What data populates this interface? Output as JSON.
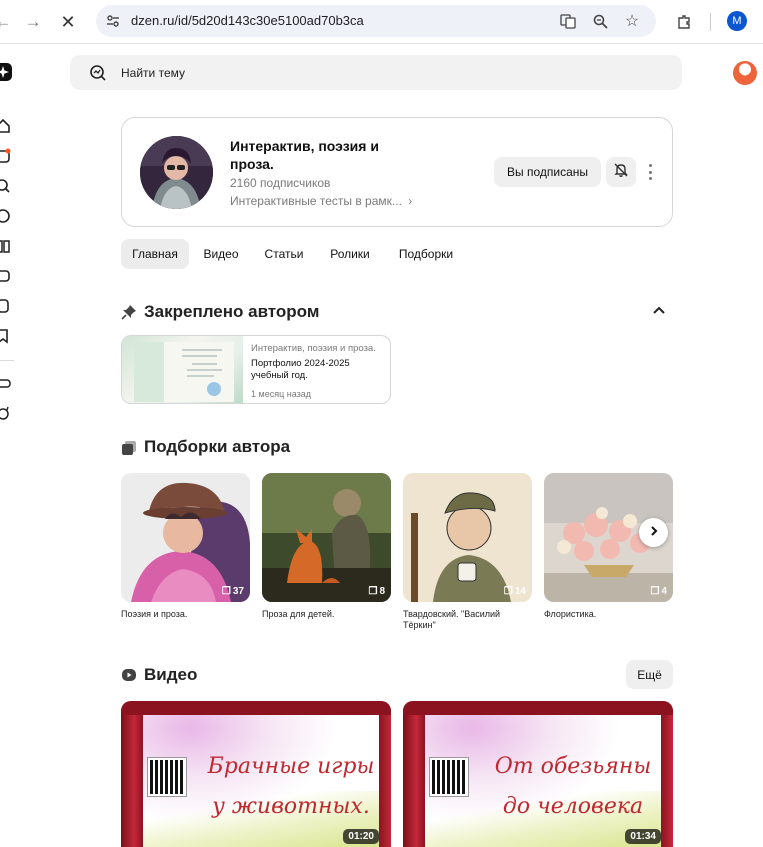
{
  "browser": {
    "url": "dzen.ru/id/5d20d143c30e5100ad70b3ca",
    "profile_initial": "M"
  },
  "search": {
    "placeholder": "Найти тему"
  },
  "channel": {
    "title": "Интерактив, поэзия и проза.",
    "subscribers": "2160 подписчиков",
    "description": "Интерактивные тесты в рамк...",
    "subscribe_label": "Вы подписаны"
  },
  "tabs": [
    "Главная",
    "Видео",
    "Статьи",
    "Ролики",
    "Подборки"
  ],
  "pinned": {
    "heading": "Закреплено автором",
    "source": "Интерактив, поэзия и проза.",
    "title": "Портфолио 2024-2025 учебный год.",
    "time": "1 месяц назад"
  },
  "collections": {
    "heading": "Подборки автора",
    "items": [
      {
        "label": "Поэзия и проза.",
        "count": "37"
      },
      {
        "label": "Проза для детей.",
        "count": "8"
      },
      {
        "label": "Твардовский. \"Василий Тёркин\"",
        "count": "14"
      },
      {
        "label": "Флористика.",
        "count": "4"
      }
    ]
  },
  "videos": {
    "heading": "Видео",
    "more_label": "Ещё",
    "items": [
      {
        "title": "Брачные игры у животных.",
        "duration": "01:20"
      },
      {
        "title": "От обезьяны до человека",
        "duration": "01:34"
      }
    ]
  },
  "colors": {
    "accent": "#0b57d0",
    "video_title": "#c0282f",
    "notification_dot": "#ff5722"
  }
}
